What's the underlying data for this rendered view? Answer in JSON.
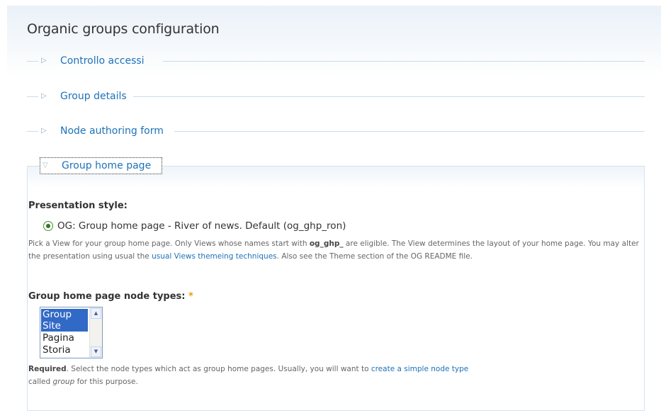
{
  "page": {
    "title": "Organic groups configuration"
  },
  "collapsed_sections": [
    {
      "label": "Controllo accessi"
    },
    {
      "label": "Group details"
    },
    {
      "label": "Node authoring form"
    }
  ],
  "open_section": {
    "label": "Group home page",
    "presentation": {
      "title": "Presentation style:",
      "option_label": "OG: Group home page - River of news. Default (og_ghp_ron)",
      "selected": true,
      "desc_part1": "Pick a View for your group home page. Only Views whose names start with ",
      "desc_bold": "og_ghp_",
      "desc_part2": " are eligible. The View determines the layout of your home page. You may alter the presentation using usual the ",
      "desc_link": "usual Views themeing techniques",
      "desc_part3": ". Also see the Theme section of the OG README file."
    },
    "node_types": {
      "title": "Group home page node types:",
      "required_marker": "*",
      "options": [
        {
          "label": "Group",
          "selected": true
        },
        {
          "label": "Site",
          "selected": true
        },
        {
          "label": "Pagina",
          "selected": false
        },
        {
          "label": "Storia",
          "selected": false
        }
      ],
      "desc_required": "Required",
      "desc_part1": ". Select the node types which act as group home pages. Usually, you will want to ",
      "desc_link": "create a simple node type",
      "desc_part2": " called ",
      "desc_italic": "group",
      "desc_part3": " for this purpose."
    }
  },
  "colors": {
    "link": "#1e72b8",
    "selected_option_bg": "#3169c6",
    "required_star": "#e8a000"
  },
  "icons": {
    "collapsed": "triangle-right-icon",
    "expanded": "triangle-down-icon"
  }
}
